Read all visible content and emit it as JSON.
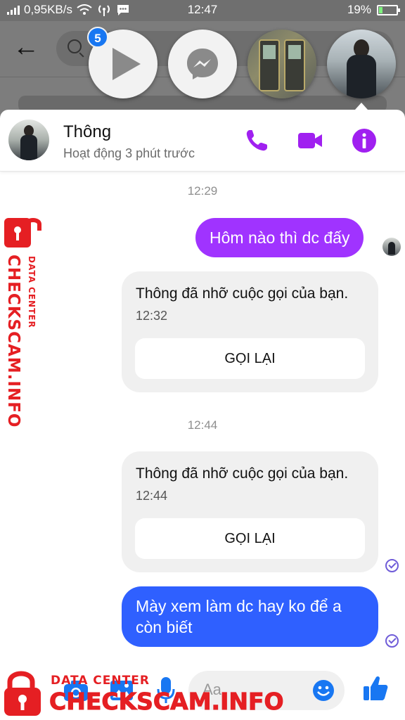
{
  "status_bar": {
    "network_speed": "0,95KB/s",
    "time": "12:47",
    "battery_percent": "19%",
    "battery_level": 0.19
  },
  "chat_heads": {
    "badge_count": "5"
  },
  "header": {
    "contact_name": "Thông",
    "status": "Hoạt động 3 phút trước"
  },
  "messages": {
    "ts1": "12:29",
    "msg1": "Hôm nào thì dc đấy",
    "call1": {
      "text": "Thông đã nhỡ cuộc gọi của bạn.",
      "time": "12:32",
      "button": "GỌI LẠI"
    },
    "ts2": "12:44",
    "call2": {
      "text": "Thông đã nhỡ cuộc gọi của bạn.",
      "time": "12:44",
      "button": "GỌI LẠI"
    },
    "msg2_line1": "Mày xem làm dc hay ko để a",
    "msg2_line2": "còn biết"
  },
  "composer": {
    "placeholder": "Aa"
  },
  "watermark": {
    "side_big": "CHECKSCAM.INFO",
    "side_small": "DATA CENTER",
    "bottom_small": "DATA CENTER",
    "bottom_big": "CHECKSCAM.INFO"
  },
  "colors": {
    "accent_purple": "#a033ff",
    "accent_blue": "#2f60ff",
    "header_icons": "#a020f0",
    "composer_icons": "#1877f2",
    "watermark_red": "#e51f23"
  },
  "icons": {
    "header": [
      "phone-icon",
      "video-call-icon",
      "info-icon"
    ],
    "composer": [
      "camera-icon",
      "image-icon",
      "microphone-icon",
      "emoji-icon",
      "like-icon"
    ]
  }
}
